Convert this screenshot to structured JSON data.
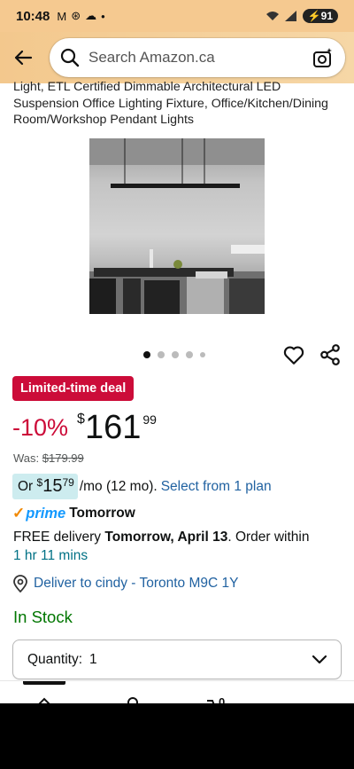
{
  "status_bar": {
    "time": "10:48",
    "left_icons": [
      "M",
      "⊛",
      "☁",
      "•"
    ],
    "battery": "91"
  },
  "search": {
    "placeholder": "Search Amazon.ca"
  },
  "product": {
    "title": "Light, ETL Certified Dimmable Architectural LED Suspension Office Lighting Fixture, Office/Kitchen/Dining Room/Workshop Pendant Lights",
    "image_alt": "Linear pendant light above dining table",
    "deal_badge": "Limited-time deal",
    "discount": "-10%",
    "currency_symbol": "$",
    "price_whole": "161",
    "price_cents": "99",
    "was_label": "Was:",
    "was_price": "$179.99",
    "monthly_prefix": "Or",
    "monthly_currency": "$",
    "monthly_whole": "15",
    "monthly_cents": "79",
    "monthly_suffix": "/mo (12 mo).",
    "monthly_link": "Select from 1 plan",
    "prime_check": "✓",
    "prime_word": "prime",
    "prime_delivery": "Tomorrow",
    "delivery_free": "FREE delivery ",
    "delivery_date": "Tomorrow, April 13",
    "delivery_order": ". Order within ",
    "delivery_countdown": "1 hr 11 mins",
    "deliver_to": "Deliver to cindy - Toronto M9C 1Y",
    "stock": "In Stock",
    "quantity_label": "Quantity:",
    "quantity_value": "1"
  },
  "carousel": {
    "dot_count": 5,
    "active_index": 0
  },
  "colors": {
    "header": "#f3c88d",
    "deal_red": "#cc0c39",
    "link_blue": "#2162a1",
    "stock_green": "#007600",
    "prime_blue": "#1399ff",
    "monthly_bg": "#cdecef"
  },
  "icons": {
    "back": "back-arrow-icon",
    "search": "search-icon",
    "camera": "camera-icon",
    "heart": "heart-icon",
    "share": "share-icon",
    "location": "location-pin-icon",
    "chevron": "chevron-down-icon"
  }
}
